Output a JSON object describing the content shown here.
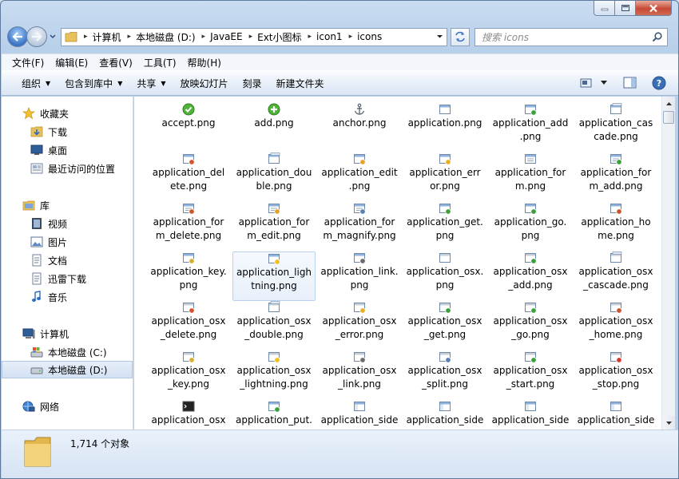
{
  "address": {
    "crumbs": [
      "计算机",
      "本地磁盘 (D:)",
      "JavaEE",
      "Ext小图标",
      "icon1",
      "icons"
    ]
  },
  "search": {
    "placeholder": "搜索 icons"
  },
  "menu": [
    "文件(F)",
    "编辑(E)",
    "查看(V)",
    "工具(T)",
    "帮助(H)"
  ],
  "toolbar": {
    "organize": "组织",
    "include_library": "包含到库中",
    "share": "共享",
    "slideshow": "放映幻灯片",
    "burn": "刻录",
    "new_folder": "新建文件夹"
  },
  "nav": {
    "favorites": "收藏夹",
    "downloads": "下载",
    "desktop": "桌面",
    "recent": "最近访问的位置",
    "libraries": "库",
    "videos": "视频",
    "pictures": "图片",
    "documents": "文档",
    "xunlei": "迅雷下载",
    "music": "音乐",
    "computer": "计算机",
    "drive_c": "本地磁盘 (C:)",
    "drive_d": "本地磁盘 (D:)",
    "network": "网络"
  },
  "files": [
    "accept.png",
    "add.png",
    "anchor.png",
    "application.png",
    "application_add.png",
    "application_cascade.png",
    "application_delete.png",
    "application_double.png",
    "application_edit.png",
    "application_error.png",
    "application_form.png",
    "application_form_add.png",
    "application_form_delete.png",
    "application_form_edit.png",
    "application_form_magnify.png",
    "application_get.png",
    "application_go.png",
    "application_home.png",
    "application_key.png",
    "application_lightning.png",
    "application_link.png",
    "application_osx.png",
    "application_osx_add.png",
    "application_osx_cascade.png",
    "application_osx_delete.png",
    "application_osx_double.png",
    "application_osx_error.png",
    "application_osx_get.png",
    "application_osx_go.png",
    "application_osx_home.png",
    "application_osx_key.png",
    "application_osx_lightning.png",
    "application_osx_link.png",
    "application_osx_split.png",
    "application_osx_start.png",
    "application_osx_stop.png",
    "application_osx",
    "application_put.",
    "application_side",
    "application_side",
    "application_side",
    "application_side"
  ],
  "file_display": [
    [
      "accept.png"
    ],
    [
      "add.png"
    ],
    [
      "anchor.png"
    ],
    [
      "application.png"
    ],
    [
      "application_add",
      ".png"
    ],
    [
      "application_cas",
      "cade.png"
    ],
    [
      "application_del",
      "ete.png"
    ],
    [
      "application_dou",
      "ble.png"
    ],
    [
      "application_edit",
      ".png"
    ],
    [
      "application_err",
      "or.png"
    ],
    [
      "application_for",
      "m.png"
    ],
    [
      "application_for",
      "m_add.png"
    ],
    [
      "application_for",
      "m_delete.png"
    ],
    [
      "application_for",
      "m_edit.png"
    ],
    [
      "application_for",
      "m_magnify.png"
    ],
    [
      "application_get.",
      "png"
    ],
    [
      "application_go.",
      "png"
    ],
    [
      "application_ho",
      "me.png"
    ],
    [
      "application_key.",
      "png"
    ],
    [
      "application_ligh",
      "tning.png"
    ],
    [
      "application_link.",
      "png"
    ],
    [
      "application_osx.",
      "png"
    ],
    [
      "application_osx",
      "_add.png"
    ],
    [
      "application_osx",
      "_cascade.png"
    ],
    [
      "application_osx",
      "_delete.png"
    ],
    [
      "application_osx",
      "_double.png"
    ],
    [
      "application_osx",
      "_error.png"
    ],
    [
      "application_osx",
      "_get.png"
    ],
    [
      "application_osx",
      "_go.png"
    ],
    [
      "application_osx",
      "_home.png"
    ],
    [
      "application_osx",
      "_key.png"
    ],
    [
      "application_osx",
      "_lightning.png"
    ],
    [
      "application_osx",
      "_link.png"
    ],
    [
      "application_osx",
      "_split.png"
    ],
    [
      "application_osx",
      "_start.png"
    ],
    [
      "application_osx",
      "_stop.png"
    ],
    [
      "application_osx"
    ],
    [
      "application_put."
    ],
    [
      "application_side"
    ],
    [
      "application_side"
    ],
    [
      "application_side"
    ],
    [
      "application_side"
    ]
  ],
  "file_icons": [
    "accept-icon",
    "add-icon",
    "anchor-icon",
    "window-icon",
    "window-add-icon",
    "window-cascade-icon",
    "window-delete-icon",
    "window-double-icon",
    "window-edit-icon",
    "window-error-icon",
    "window-form-icon",
    "window-form-add-icon",
    "window-form-delete-icon",
    "window-form-edit-icon",
    "window-form-magnify-icon",
    "window-get-icon",
    "window-go-icon",
    "window-home-icon",
    "window-key-icon",
    "window-lightning-icon",
    "window-link-icon",
    "window-osx-icon",
    "window-osx-add-icon",
    "window-osx-cascade-icon",
    "window-osx-delete-icon",
    "window-osx-double-icon",
    "window-osx-error-icon",
    "window-osx-get-icon",
    "window-osx-go-icon",
    "window-osx-home-icon",
    "window-osx-key-icon",
    "window-osx-lightning-icon",
    "window-osx-link-icon",
    "window-osx-split-icon",
    "window-osx-start-icon",
    "window-osx-stop-icon",
    "terminal-icon",
    "window-put-icon",
    "window-side-icon",
    "window-side-icon",
    "window-side-icon",
    "window-side-icon"
  ],
  "status": {
    "count": "1,714 个对象"
  },
  "colors": {
    "accent": "#3a74c4",
    "selection": "#d3e1f3",
    "hover_border": "#b9d1ee"
  }
}
